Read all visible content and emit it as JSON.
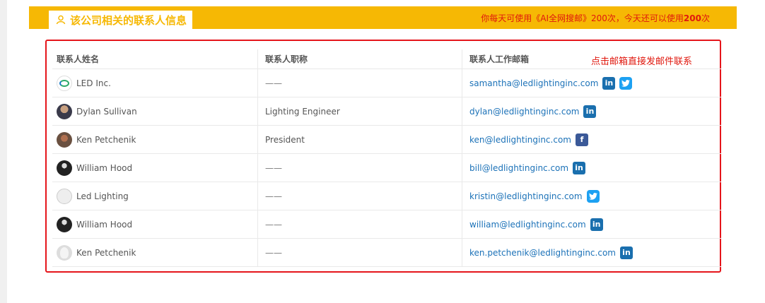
{
  "header": {
    "title": "该公司相关的联系人信息",
    "quota_prefix": "你每天可使用《AI全网搜邮》200次，今天还可以使用",
    "quota_count": "200",
    "quota_suffix": "次"
  },
  "table": {
    "columns": [
      "联系人姓名",
      "联系人职称",
      "联系人工作邮箱"
    ],
    "hint": "点击邮箱直接发邮件联系",
    "rows": [
      {
        "name": "LED Inc.",
        "title": "——",
        "email": "samantha@ledlightinginc.com",
        "avatar": "company-logo",
        "socials": [
          "linkedin",
          "twitter"
        ]
      },
      {
        "name": "Dylan Sullivan",
        "title": "Lighting Engineer",
        "email": "dylan@ledlightinginc.com",
        "avatar": "photo",
        "socials": [
          "linkedin"
        ]
      },
      {
        "name": "Ken Petchenik",
        "title": "President",
        "email": "ken@ledlightinginc.com",
        "avatar": "photo",
        "socials": [
          "facebook"
        ]
      },
      {
        "name": "William Hood",
        "title": "——",
        "email": "bill@ledlightinginc.com",
        "avatar": "photo",
        "socials": [
          "linkedin"
        ]
      },
      {
        "name": "Led Lighting",
        "title": "——",
        "email": "kristin@ledlightinginc.com",
        "avatar": "logo",
        "socials": [
          "twitter"
        ]
      },
      {
        "name": "William Hood",
        "title": "——",
        "email": "william@ledlightinginc.com",
        "avatar": "photo",
        "socials": [
          "linkedin"
        ]
      },
      {
        "name": "Ken Petchenik",
        "title": "——",
        "email": "ken.petchenik@ledlightinginc.com",
        "avatar": "default",
        "socials": [
          "linkedin"
        ]
      }
    ]
  },
  "icons": {
    "linkedin": "in",
    "facebook": "f",
    "twitter": "t"
  },
  "colors": {
    "accent": "#f6b804",
    "highlight": "#e0180e",
    "link": "#1c72b8"
  }
}
